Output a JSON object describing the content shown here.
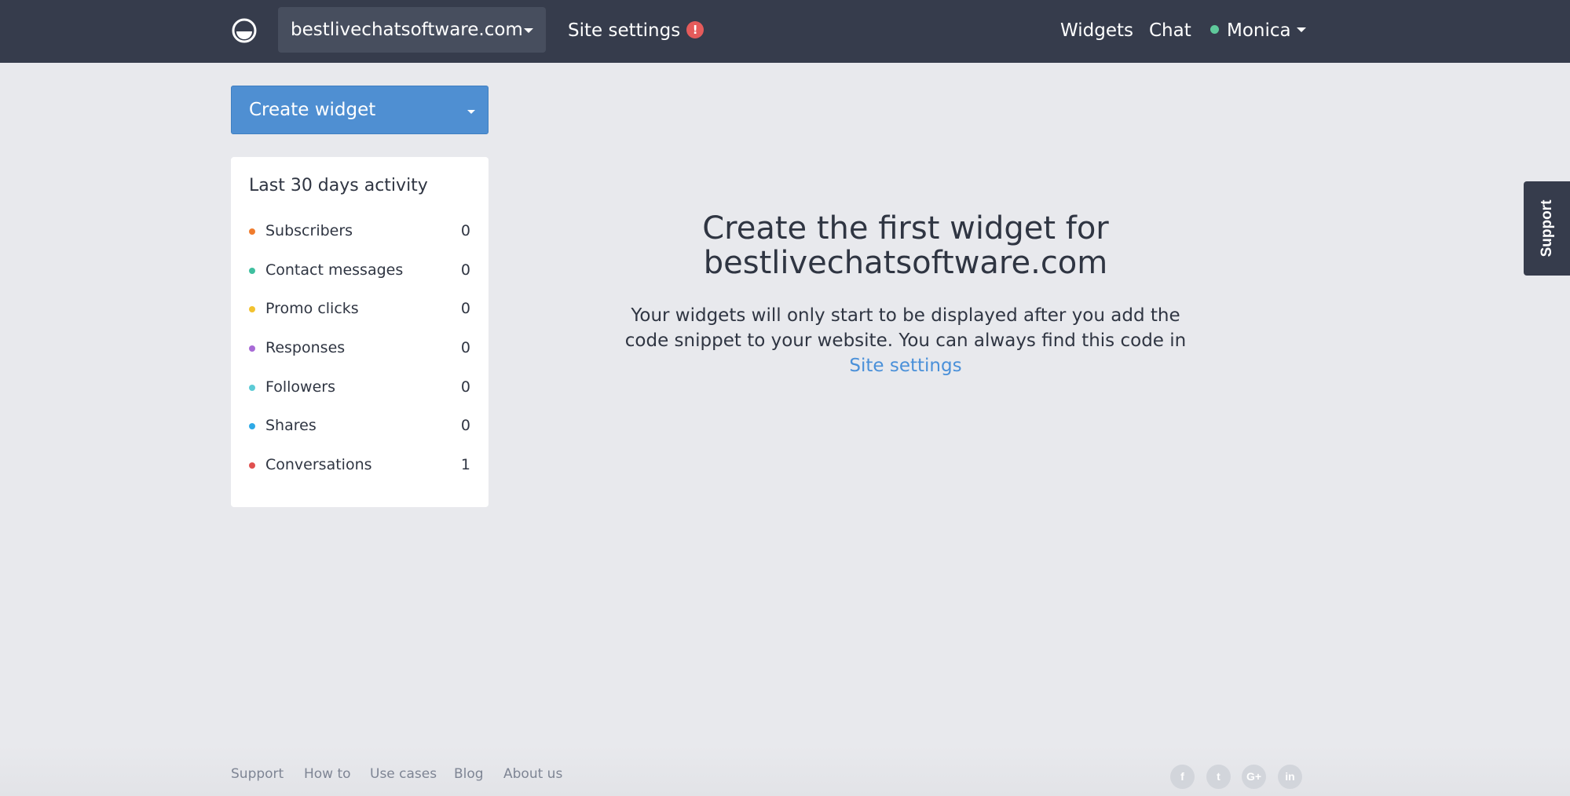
{
  "nav": {
    "site": "bestlivechatsoftware.com",
    "site_settings": "Site settings",
    "site_settings_badge": "!",
    "widgets": "Widgets",
    "chat": "Chat",
    "user": "Monica"
  },
  "create_button": {
    "label": "Create widget"
  },
  "activity": {
    "title": "Last 30 days activity",
    "rows": [
      {
        "label": "Subscribers",
        "value": "0",
        "color": "#f07c2e"
      },
      {
        "label": "Contact messages",
        "value": "0",
        "color": "#3fbf9f"
      },
      {
        "label": "Promo clicks",
        "value": "0",
        "color": "#f2c230"
      },
      {
        "label": "Responses",
        "value": "0",
        "color": "#a86ad6"
      },
      {
        "label": "Followers",
        "value": "0",
        "color": "#5ccbd6"
      },
      {
        "label": "Shares",
        "value": "0",
        "color": "#2fa9e6"
      },
      {
        "label": "Conversations",
        "value": "1",
        "color": "#e0504f"
      }
    ]
  },
  "empty_state": {
    "title_line1": "Create the first widget for",
    "title_line2": "bestlivechatsoftware.com",
    "text": "Your widgets will only start to be displayed after you add the code snippet to your website. You can always find this code in ",
    "link": "Site settings"
  },
  "support_tab": "Support",
  "footer": {
    "links": [
      "Support",
      "How to",
      "Use cases",
      "Blog",
      "About us"
    ],
    "social": [
      {
        "icon": "facebook-icon",
        "glyph": "f"
      },
      {
        "icon": "twitter-icon",
        "glyph": "t"
      },
      {
        "icon": "google-plus-icon",
        "glyph": "G+"
      },
      {
        "icon": "linkedin-icon",
        "glyph": "in"
      }
    ]
  },
  "colors": {
    "topbar": "#363c4c",
    "accent": "#4f8fd2",
    "link": "#4a90d9",
    "online": "#5fc99b",
    "alert": "#e55b5b"
  }
}
